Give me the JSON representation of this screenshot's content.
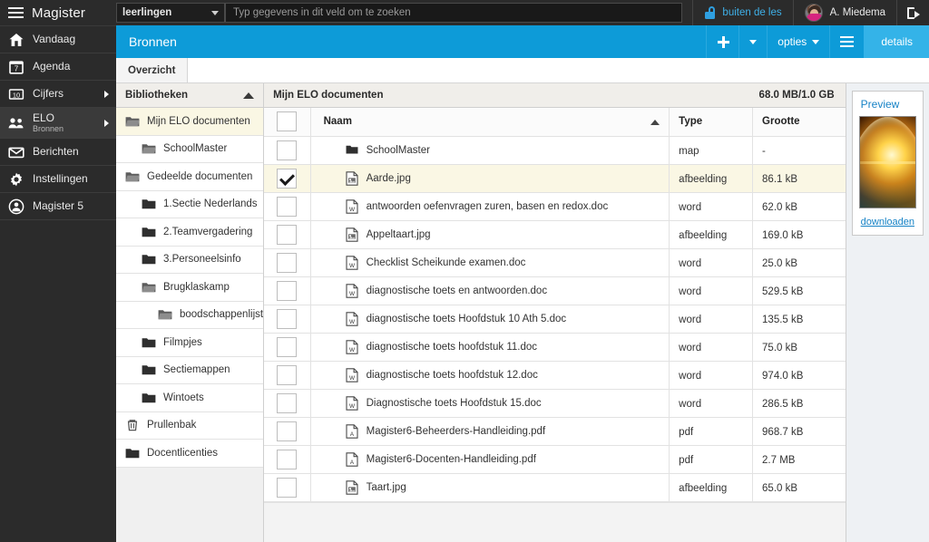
{
  "topbar": {
    "brand": "Magister",
    "menu_icon": "hamburger-icon",
    "role_select": {
      "value": "leerlingen"
    },
    "search": {
      "placeholder": "Typ gegevens in dit veld om te zoeken",
      "value": ""
    },
    "status": {
      "label": "buiten de les",
      "icon": "unlock-icon"
    },
    "user": {
      "name": "A. Miedema"
    },
    "logout": {
      "icon": "logout-icon"
    }
  },
  "sidebar": {
    "items": [
      {
        "label": "Vandaag",
        "icon": "home-icon",
        "sub": "",
        "arrow": false,
        "active": false
      },
      {
        "label": "Agenda",
        "icon": "calendar-icon",
        "sub": "",
        "arrow": false,
        "active": false
      },
      {
        "label": "Cijfers",
        "icon": "grades-icon",
        "sub": "",
        "arrow": true,
        "active": false
      },
      {
        "label": "ELO",
        "icon": "people-icon",
        "sub": "Bronnen",
        "arrow": true,
        "active": true
      },
      {
        "label": "Berichten",
        "icon": "envelope-icon",
        "sub": "",
        "arrow": false,
        "active": false
      },
      {
        "label": "Instellingen",
        "icon": "gear-icon",
        "sub": "",
        "arrow": false,
        "active": false
      },
      {
        "label": "Magister 5",
        "icon": "magister5-icon",
        "sub": "",
        "arrow": false,
        "active": false
      }
    ]
  },
  "module": {
    "title": "Bronnen",
    "add_label": "",
    "options_label": "opties",
    "menu_icon": "list-icon",
    "details_label": "details",
    "accent_color": "#0d9bd8",
    "accent_active_color": "#34b3e8"
  },
  "tabs": [
    {
      "label": "Overzicht",
      "active": true
    }
  ],
  "tree": {
    "header": "Bibliotheken",
    "collapse_icon": "chevron-up-icon",
    "items": [
      {
        "label": "Mijn ELO documenten",
        "level": 0,
        "icon": "folder-open-icon",
        "selected": true
      },
      {
        "label": "SchoolMaster",
        "level": 1,
        "icon": "folder-open-icon",
        "selected": false
      },
      {
        "label": "Gedeelde documenten",
        "level": 0,
        "icon": "folder-open-icon",
        "selected": false
      },
      {
        "label": "1.Sectie Nederlands",
        "level": 1,
        "icon": "folder-icon",
        "selected": false
      },
      {
        "label": "2.Teamvergadering",
        "level": 1,
        "icon": "folder-icon",
        "selected": false
      },
      {
        "label": "3.Personeelsinfo",
        "level": 1,
        "icon": "folder-icon",
        "selected": false
      },
      {
        "label": "Brugklaskamp",
        "level": 1,
        "icon": "folder-open-icon",
        "selected": false
      },
      {
        "label": "boodschappenlijst",
        "level": 2,
        "icon": "folder-open-icon",
        "selected": false
      },
      {
        "label": "Filmpjes",
        "level": 1,
        "icon": "folder-icon",
        "selected": false
      },
      {
        "label": "Sectiemappen",
        "level": 1,
        "icon": "folder-icon",
        "selected": false
      },
      {
        "label": "Wintoets",
        "level": 1,
        "icon": "folder-icon",
        "selected": false
      },
      {
        "label": "Prullenbak",
        "level": 0,
        "icon": "trash-icon",
        "selected": false
      },
      {
        "label": "Docentlicenties",
        "level": 0,
        "icon": "folder-icon",
        "selected": false
      }
    ]
  },
  "files": {
    "header_title": "Mijn ELO documenten",
    "header_quota": "68.0 MB/1.0 GB",
    "columns": {
      "check": "",
      "name": "Naam",
      "type": "Type",
      "size": "Grootte"
    },
    "sort": {
      "column": "Naam",
      "direction": "asc",
      "icon": "sort-asc-icon"
    },
    "rows": [
      {
        "name": "SchoolMaster",
        "type": "map",
        "size": "-",
        "icon": "folder-icon",
        "checked": false,
        "selected": false
      },
      {
        "name": "Aarde.jpg",
        "type": "afbeelding",
        "size": "86.1 kB",
        "icon": "image-file-icon",
        "checked": true,
        "selected": true
      },
      {
        "name": "antwoorden oefenvragen zuren, basen en redox.doc",
        "type": "word",
        "size": "62.0 kB",
        "icon": "word-file-icon",
        "checked": false,
        "selected": false
      },
      {
        "name": "Appeltaart.jpg",
        "type": "afbeelding",
        "size": "169.0 kB",
        "icon": "image-file-icon",
        "checked": false,
        "selected": false
      },
      {
        "name": "Checklist Scheikunde examen.doc",
        "type": "word",
        "size": "25.0 kB",
        "icon": "word-file-icon",
        "checked": false,
        "selected": false
      },
      {
        "name": "diagnostische toets en antwoorden.doc",
        "type": "word",
        "size": "529.5 kB",
        "icon": "word-file-icon",
        "checked": false,
        "selected": false
      },
      {
        "name": "diagnostische toets Hoofdstuk 10 Ath 5.doc",
        "type": "word",
        "size": "135.5 kB",
        "icon": "word-file-icon",
        "checked": false,
        "selected": false
      },
      {
        "name": "diagnostische toets hoofdstuk 11.doc",
        "type": "word",
        "size": "75.0 kB",
        "icon": "word-file-icon",
        "checked": false,
        "selected": false
      },
      {
        "name": "diagnostische toets hoofdstuk 12.doc",
        "type": "word",
        "size": "974.0 kB",
        "icon": "word-file-icon",
        "checked": false,
        "selected": false
      },
      {
        "name": "Diagnostische toets Hoofdstuk 15.doc",
        "type": "word",
        "size": "286.5 kB",
        "icon": "word-file-icon",
        "checked": false,
        "selected": false
      },
      {
        "name": "Magister6-Beheerders-Handleiding.pdf",
        "type": "pdf",
        "size": "968.7 kB",
        "icon": "pdf-file-icon",
        "checked": false,
        "selected": false
      },
      {
        "name": "Magister6-Docenten-Handleiding.pdf",
        "type": "pdf",
        "size": "2.7 MB",
        "icon": "pdf-file-icon",
        "checked": false,
        "selected": false
      },
      {
        "name": "Taart.jpg",
        "type": "afbeelding",
        "size": "65.0 kB",
        "icon": "image-file-icon",
        "checked": false,
        "selected": false
      }
    ]
  },
  "preview": {
    "title": "Preview",
    "image_alt": "Aarde.jpg",
    "download_label": "downloaden"
  }
}
